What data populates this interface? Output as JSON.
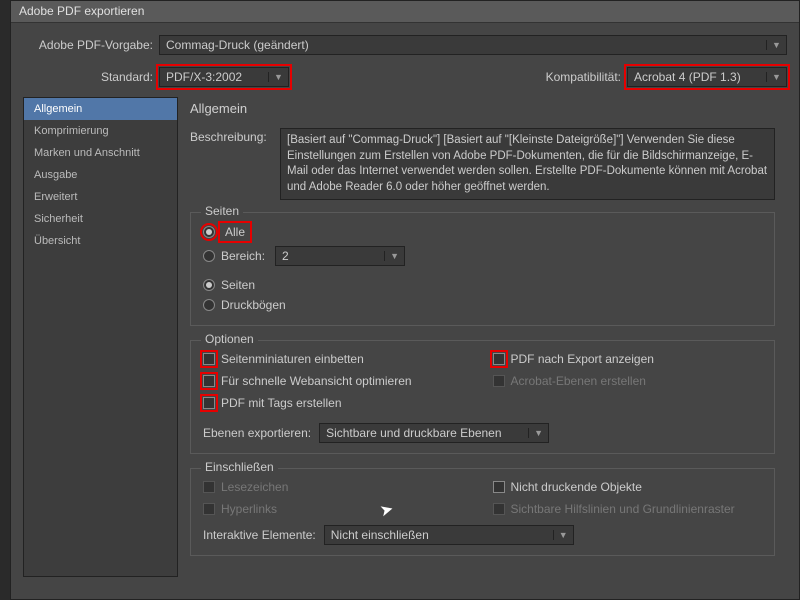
{
  "window": {
    "title": "Adobe PDF exportieren"
  },
  "header": {
    "preset_label": "Adobe PDF-Vorgabe:",
    "preset_value": "Commag-Druck (geändert)",
    "standard_label": "Standard:",
    "standard_value": "PDF/X-3:2002",
    "compat_label": "Kompatibilität:",
    "compat_value": "Acrobat 4 (PDF 1.3)"
  },
  "sidebar": {
    "items": [
      "Allgemein",
      "Komprimierung",
      "Marken und Anschnitt",
      "Ausgabe",
      "Erweitert",
      "Sicherheit",
      "Übersicht"
    ]
  },
  "content": {
    "title": "Allgemein",
    "desc_label": "Beschreibung:",
    "desc_text": "[Basiert auf \"Commag-Druck\"] [Basiert auf \"[Kleinste Dateigröße]\"] Verwenden Sie diese Einstellungen zum Erstellen von Adobe PDF-Dokumenten, die für die Bildschirmanzeige, E-Mail oder das Internet verwendet werden sollen. Erstellte PDF-Dokumente können mit Acrobat und Adobe Reader 6.0 oder höher geöffnet werden.",
    "pages": {
      "legend": "Seiten",
      "all": "Alle",
      "range": "Bereich:",
      "range_value": "2",
      "pages_radio": "Seiten",
      "spreads_radio": "Druckbögen"
    },
    "options": {
      "legend": "Optionen",
      "thumb": "Seitenminiaturen einbetten",
      "fastweb": "Für schnelle Webansicht optimieren",
      "tagged": "PDF mit Tags erstellen",
      "viewafter": "PDF nach Export anzeigen",
      "acrolayers": "Acrobat-Ebenen erstellen",
      "layers_label": "Ebenen exportieren:",
      "layers_value": "Sichtbare und druckbare Ebenen"
    },
    "include": {
      "legend": "Einschließen",
      "bookmarks": "Lesezeichen",
      "hyperlinks": "Hyperlinks",
      "nonprint": "Nicht druckende Objekte",
      "guides": "Sichtbare Hilfslinien und Grundlinienraster",
      "interactive_label": "Interaktive Elemente:",
      "interactive_value": "Nicht einschließen"
    }
  }
}
